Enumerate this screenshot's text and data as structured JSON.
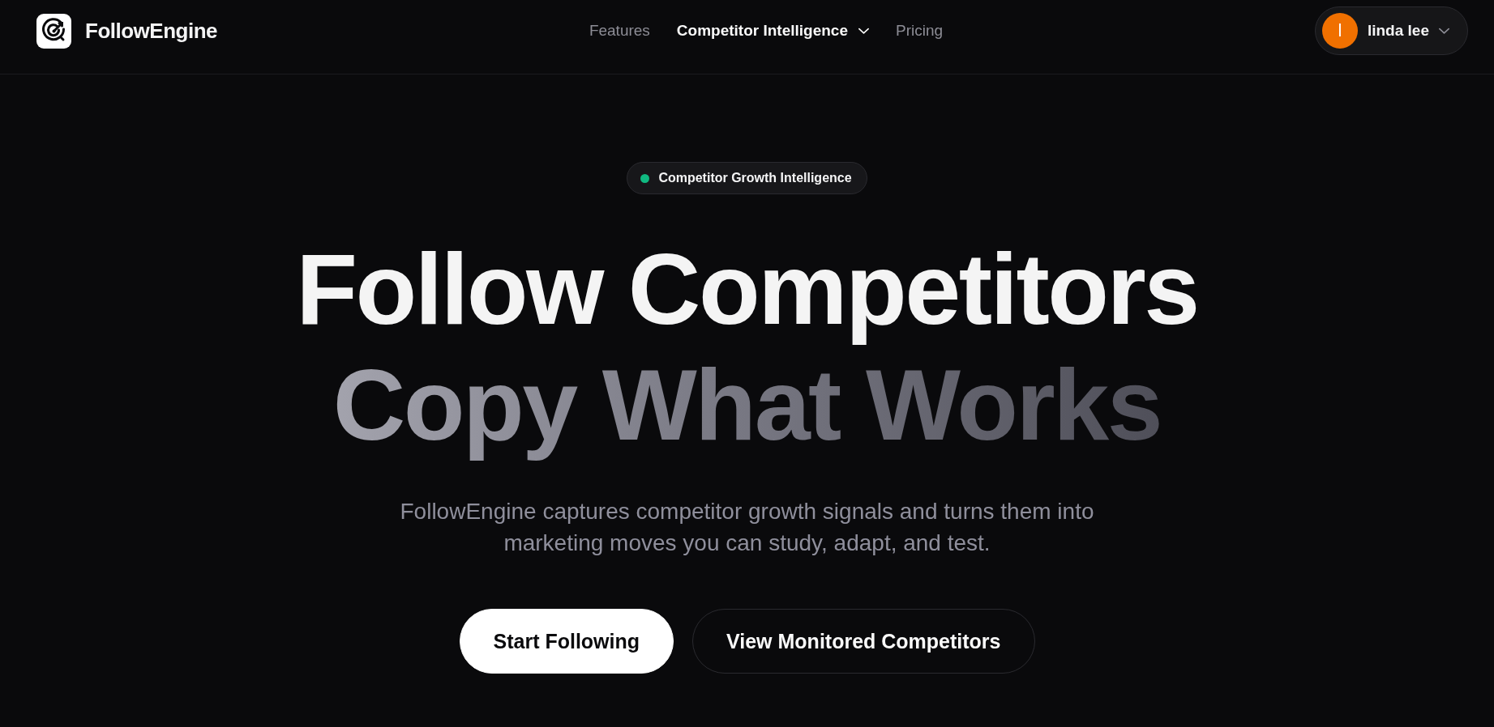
{
  "header": {
    "brand": "FollowEngine",
    "nav": [
      {
        "label": "Features",
        "selected": false,
        "has_menu": false
      },
      {
        "label": "Competitor Intelligence",
        "selected": true,
        "has_menu": true
      },
      {
        "label": "Pricing",
        "selected": false,
        "has_menu": false
      }
    ],
    "user": {
      "initial": "l",
      "name": "linda lee"
    }
  },
  "hero": {
    "badge": "Competitor Growth Intelligence",
    "title": {
      "line_1": "Follow Competitors",
      "line_2": "Copy What Works"
    },
    "description": "FollowEngine captures competitor growth signals and turns them into marketing moves you can study, adapt, and test.",
    "buttons": [
      {
        "label": "Start Following",
        "kind": "primary"
      },
      {
        "label": "View Monitored Competitors",
        "kind": "secondary"
      }
    ]
  }
}
